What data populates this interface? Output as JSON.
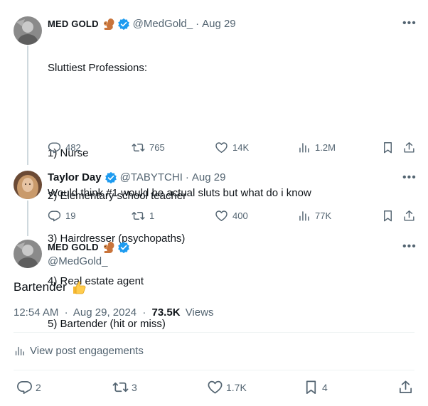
{
  "tweet1": {
    "name": "MED GOLD",
    "handle": "@MedGold_",
    "date": "Aug 29",
    "lines": [
      "Sluttiest Professions:",
      "",
      "1) Nurse",
      "2) Elementary school teacher",
      "3) Hairdresser (psychopaths)",
      "4) Real estate agent",
      "5) Bartender (hit or miss)"
    ],
    "replies": "482",
    "retweets": "765",
    "likes": "14K",
    "views": "1.2M"
  },
  "tweet2": {
    "name": "Taylor Day",
    "handle": "@TABYTCHI",
    "date": "Aug 29",
    "text": "Would think #1 would be actual sluts but what do i know",
    "replies": "19",
    "retweets": "1",
    "likes": "400",
    "views": "77K"
  },
  "main": {
    "name": "MED GOLD",
    "handle": "@MedGold_",
    "text": "Bartender",
    "time": "12:54 AM",
    "date": "Aug 29, 2024",
    "views_count": "73.5K",
    "views_label": "Views",
    "engagements_label": "View post engagements",
    "replies": "2",
    "retweets": "3",
    "likes": "1.7K",
    "bookmarks": "4"
  },
  "colors": {
    "verified": "#1d9bf0",
    "secondary_text": "#536471",
    "thread_line": "#cfd9de"
  },
  "separator": "·"
}
